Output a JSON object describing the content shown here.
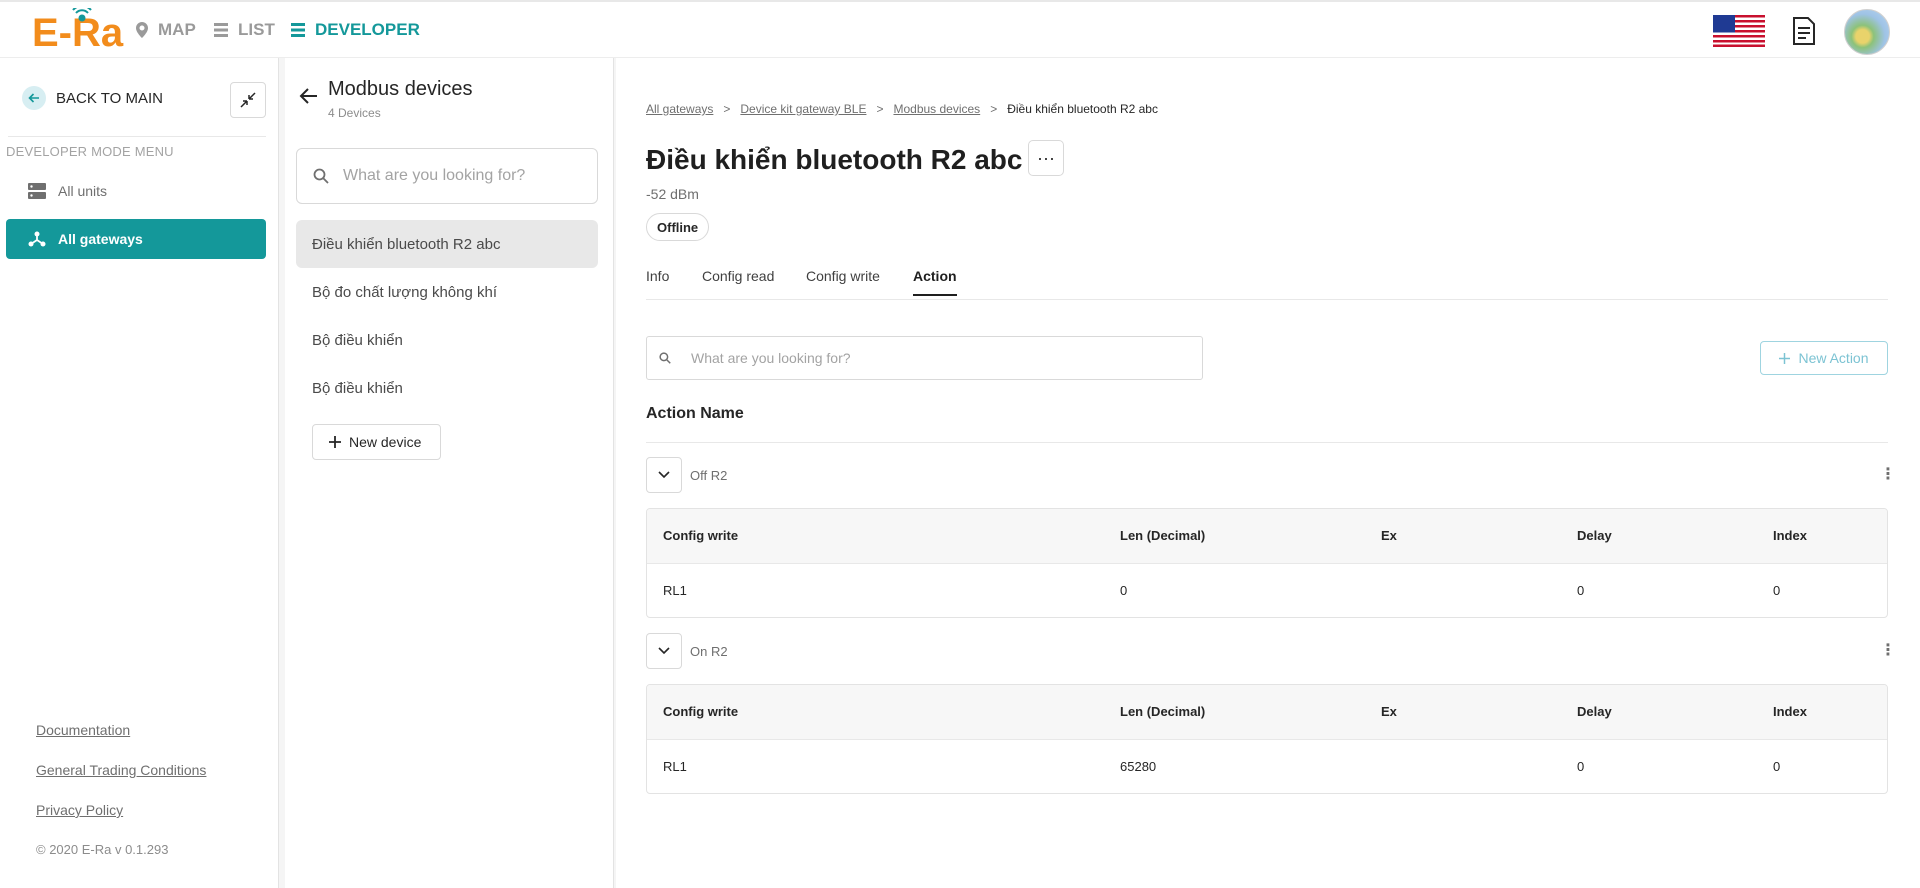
{
  "topbar": {
    "logo": "E-Ra",
    "nav": [
      {
        "label": "MAP",
        "icon": "map-pin-icon"
      },
      {
        "label": "LIST",
        "icon": "list-icon"
      },
      {
        "label": "DEVELOPER",
        "icon": "developer-icon"
      }
    ],
    "active_nav": "DEVELOPER",
    "flag": "us-flag-icon"
  },
  "sidebar": {
    "back_label": "BACK TO MAIN",
    "menu_header": "DEVELOPER MODE MENU",
    "items": [
      {
        "label": "All units",
        "icon": "units-icon"
      },
      {
        "label": "All gateways",
        "icon": "gateways-icon"
      }
    ],
    "active_item": "All gateways",
    "footer_links": [
      "Documentation",
      "General Trading Conditions",
      "Privacy Policy"
    ],
    "copyright": "© 2020 E-Ra v 0.1.293"
  },
  "device_panel": {
    "title": "Modbus devices",
    "count": "4 Devices",
    "search_placeholder": "What are you looking for?",
    "devices": [
      "Điều khiển bluetooth R2 abc",
      "Bộ đo chất lượng không khí",
      "Bộ điều khiển",
      "Bộ điều khiển"
    ],
    "active_device": "Điều khiển bluetooth R2 abc",
    "new_device_label": "New device"
  },
  "main": {
    "breadcrumbs": [
      "All gateways",
      "Device kit gateway BLE",
      "Modbus devices",
      "Điều khiển bluetooth R2 abc"
    ],
    "title": "Điều khiển bluetooth R2 abc",
    "more_label": "···",
    "signal": "-52 dBm",
    "status": "Offline",
    "tabs": [
      "Info",
      "Config read",
      "Config write",
      "Action"
    ],
    "active_tab": "Action",
    "action_search_placeholder": "What are you looking for?",
    "new_action_label": "New Action",
    "action_name_header": "Action Name",
    "columns": [
      "Config write",
      "Len (Decimal)",
      "Ex",
      "Delay",
      "Index"
    ],
    "actions": [
      {
        "name": "Off R2",
        "rows": [
          {
            "config_write": "RL1",
            "len": "0",
            "ex": "",
            "delay": "0",
            "index": "0"
          }
        ]
      },
      {
        "name": "On R2",
        "rows": [
          {
            "config_write": "RL1",
            "len": "65280",
            "ex": "",
            "delay": "0",
            "index": "0"
          }
        ]
      }
    ]
  },
  "colors": {
    "accent": "#14989a",
    "brand": "#f28c1c",
    "new_action_border": "#9fd4e0"
  }
}
